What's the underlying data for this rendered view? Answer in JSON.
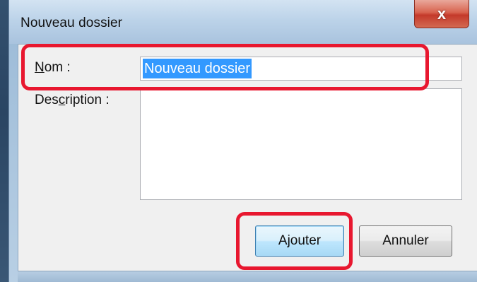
{
  "dialog": {
    "title": "Nouveau dossier",
    "close_label": "x"
  },
  "form": {
    "name_label_accel": "N",
    "name_label_rest": "om :",
    "name_value": "Nouveau dossier",
    "description_label_pre": "Des",
    "description_label_accel": "c",
    "description_label_post": "ription :",
    "description_value": ""
  },
  "buttons": {
    "add_label": "Ajouter",
    "cancel_label": "Annuler"
  },
  "colors": {
    "highlight": "#e8172f",
    "selection": "#3399ff"
  }
}
